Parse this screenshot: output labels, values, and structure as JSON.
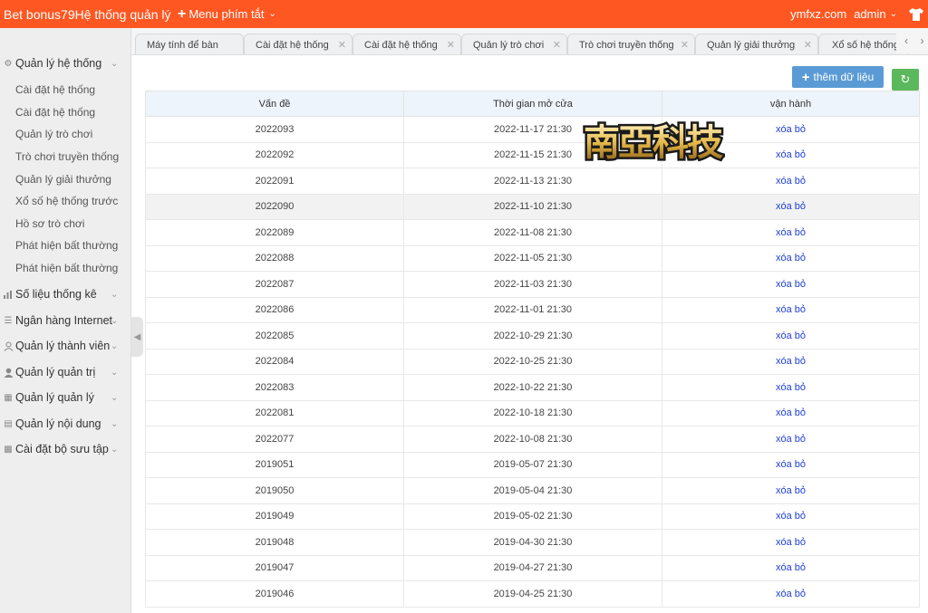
{
  "header": {
    "brand": "Bet bonus79Hệ thống quản lý",
    "menu_shortcut": "Menu phím tắt",
    "domain": "ymfxz.com",
    "user": "admin",
    "shirt_icon": "shirt-icon"
  },
  "sidebar": {
    "groups": [
      {
        "label": "Quản lý hệ thống",
        "icon": "gear-icon"
      },
      {
        "label": "Số liệu thống kê",
        "icon": "bar-chart-icon"
      },
      {
        "label": "Ngân hàng Internet",
        "icon": "list-icon"
      },
      {
        "label": "Quản lý thành viên",
        "icon": "user-outline-icon"
      },
      {
        "label": "Quản lý quản trị",
        "icon": "user-solid-icon"
      },
      {
        "label": "Quản lý quản lý",
        "icon": "grid-icon"
      },
      {
        "label": "Quản lý nội dung",
        "icon": "document-icon"
      },
      {
        "label": "Cài đặt bộ sưu tập",
        "icon": "collection-icon"
      }
    ],
    "system_items": [
      "Cài đặt hệ thống",
      "Cài đặt hệ thống",
      "Quản lý trò chơi",
      "Trò chơi truyền thống",
      "Quản lý giải thưởng",
      "Xổ số hệ thống trước",
      "Hồ sơ trò chơi",
      "Phát hiện bất thường",
      "Phát hiện bất thường"
    ]
  },
  "tabs": [
    "Máy tính để bàn",
    "Cài đặt hệ thống",
    "Cài đặt hệ thống",
    "Quản lý trò chơi",
    "Trò chơi truyền thống",
    "Quản lý giải thưởng",
    "Xổ số hệ thống"
  ],
  "toolbar": {
    "add_label": "thêm dữ liệu"
  },
  "table": {
    "headers": [
      "Vấn đề",
      "Thời gian mở cửa",
      "vận hành"
    ],
    "action_label": "xóa bỏ",
    "rows": [
      [
        "2022093",
        "2022-11-17 21:30"
      ],
      [
        "2022092",
        "2022-11-15 21:30"
      ],
      [
        "2022091",
        "2022-11-13 21:30"
      ],
      [
        "2022090",
        "2022-11-10 21:30"
      ],
      [
        "2022089",
        "2022-11-08 21:30"
      ],
      [
        "2022088",
        "2022-11-05 21:30"
      ],
      [
        "2022087",
        "2022-11-03 21:30"
      ],
      [
        "2022086",
        "2022-11-01 21:30"
      ],
      [
        "2022085",
        "2022-10-29 21:30"
      ],
      [
        "2022084",
        "2022-10-25 21:30"
      ],
      [
        "2022083",
        "2022-10-22 21:30"
      ],
      [
        "2022081",
        "2022-10-18 21:30"
      ],
      [
        "2022077",
        "2022-10-08 21:30"
      ],
      [
        "2019051",
        "2019-05-07 21:30"
      ],
      [
        "2019050",
        "2019-05-04 21:30"
      ],
      [
        "2019049",
        "2019-05-02 21:30"
      ],
      [
        "2019048",
        "2019-04-30 21:30"
      ],
      [
        "2019047",
        "2019-04-27 21:30"
      ],
      [
        "2019046",
        "2019-04-25 21:30"
      ]
    ],
    "highlighted_row": 3
  },
  "watermark": {
    "logo_text": "南亞科技"
  },
  "colors": {
    "topbar": "#ff5722",
    "add_button": "#5b9bd5",
    "refresh_button": "#5cb85c",
    "link": "#1e3fd8"
  }
}
